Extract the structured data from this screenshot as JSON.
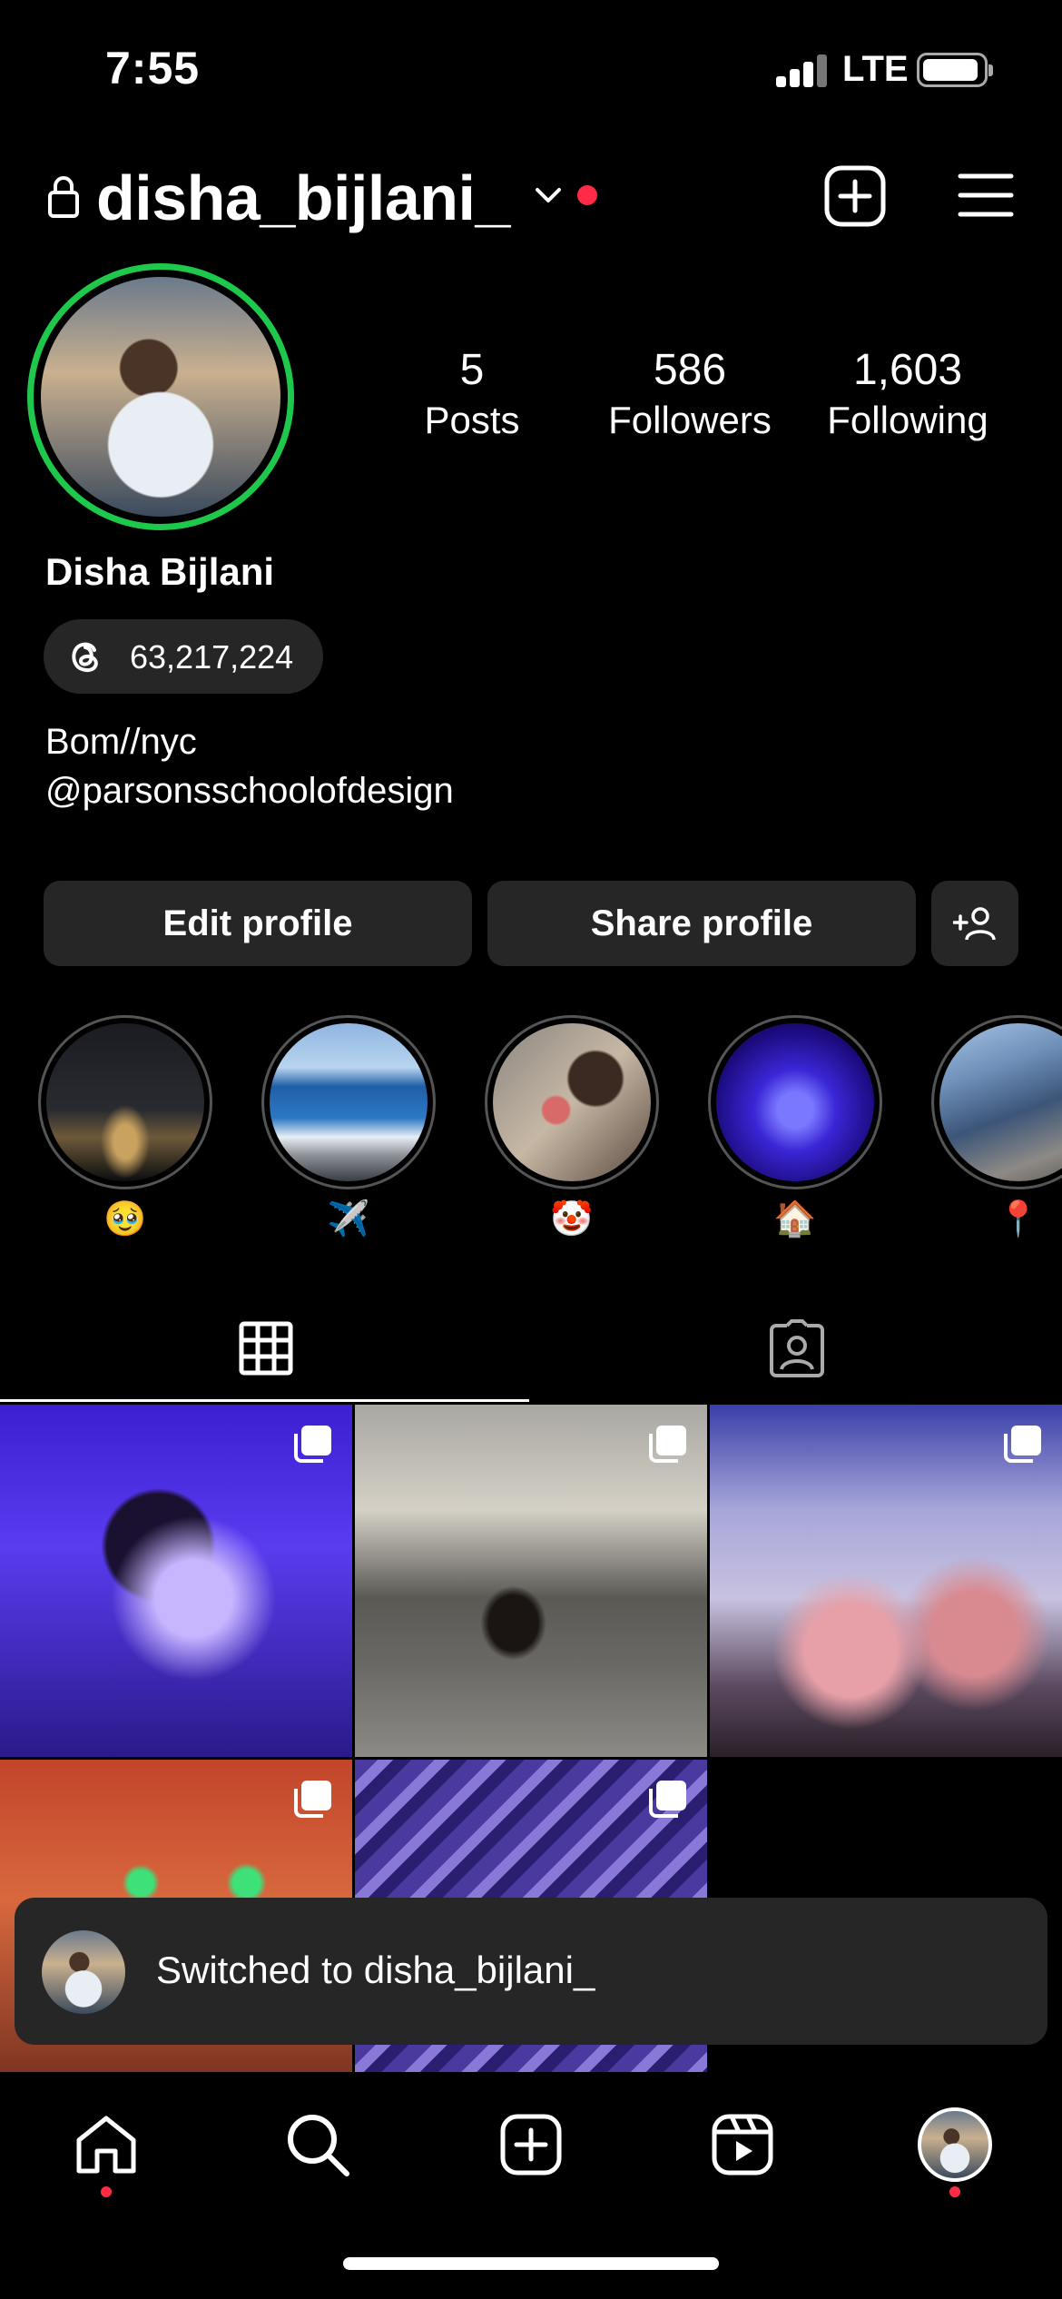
{
  "status_bar": {
    "time": "7:55",
    "network": "LTE"
  },
  "header": {
    "username": "disha_bijlani_"
  },
  "profile": {
    "display_name": "Disha Bijlani",
    "stats": [
      {
        "value": "5",
        "label": "Posts"
      },
      {
        "value": "586",
        "label": "Followers"
      },
      {
        "value": "1,603",
        "label": "Following"
      }
    ],
    "threads_count": "63,217,224",
    "bio_line1": "Bom//nyc",
    "bio_line2": "@parsonsschoolofdesign"
  },
  "actions": {
    "edit_label": "Edit profile",
    "share_label": "Share profile"
  },
  "highlights": [
    {
      "label": "🥹"
    },
    {
      "label": "✈️"
    },
    {
      "label": "🤡"
    },
    {
      "label": "🏠"
    },
    {
      "label": "📍"
    }
  ],
  "toast": {
    "text": "Switched to disha_bijlani_"
  },
  "colors": {
    "story_ring": "#1ec84b",
    "notification": "#ff2b45",
    "surface": "#262626"
  }
}
